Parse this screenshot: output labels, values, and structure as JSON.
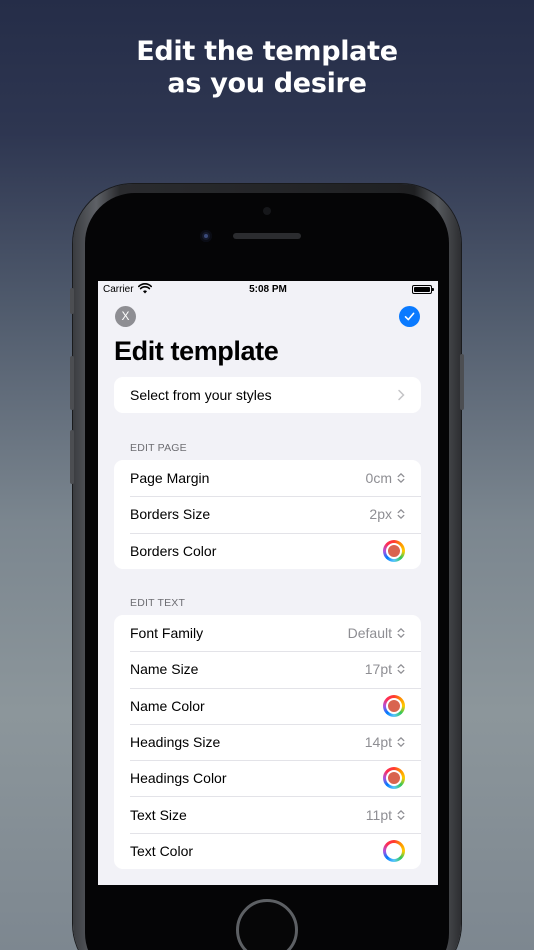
{
  "headline": {
    "line1": "Edit the template",
    "line2": "as you desire"
  },
  "status_bar": {
    "carrier": "Carrier",
    "time": "5:08 PM"
  },
  "nav": {
    "close_label": "X"
  },
  "title": "Edit template",
  "styles_row": {
    "label": "Select from your styles"
  },
  "edit_page": {
    "header": "EDIT PAGE",
    "rows": [
      {
        "label": "Page Margin",
        "value": "0cm"
      },
      {
        "label": "Borders Size",
        "value": "2px"
      },
      {
        "label": "Borders Color",
        "color": "#d9644f"
      }
    ]
  },
  "edit_text": {
    "header": "EDIT TEXT",
    "rows": [
      {
        "label": "Font Family",
        "value": "Default"
      },
      {
        "label": "Name Size",
        "value": "17pt"
      },
      {
        "label": "Name Color",
        "color": "#d9644f"
      },
      {
        "label": "Headings Size",
        "value": "14pt"
      },
      {
        "label": "Headings Color",
        "color": "#d9644f"
      },
      {
        "label": "Text Size",
        "value": "11pt"
      },
      {
        "label": "Text Color",
        "color": "#ffffff"
      }
    ]
  },
  "colors": {
    "accent": "#0a7aff",
    "background": "#f2f2f7",
    "secondary_text": "#8e8e93"
  }
}
